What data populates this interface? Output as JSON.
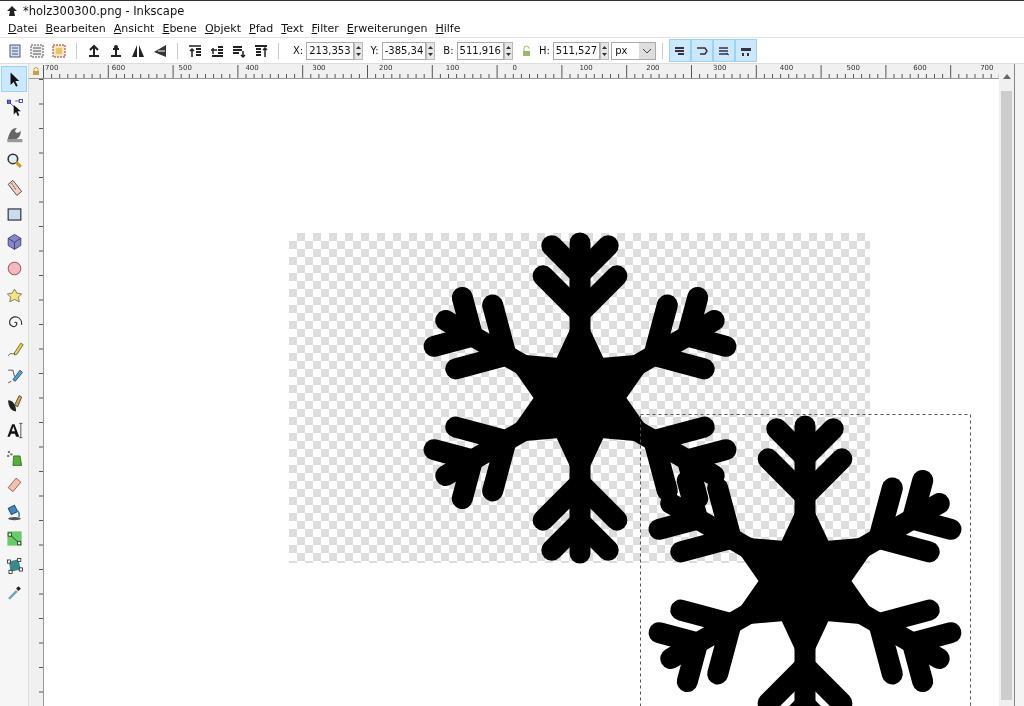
{
  "window": {
    "title": "*holz300300.png - Inkscape"
  },
  "menu": [
    {
      "label": "Datei"
    },
    {
      "label": "Bearbeiten"
    },
    {
      "label": "Ansicht"
    },
    {
      "label": "Ebene"
    },
    {
      "label": "Objekt"
    },
    {
      "label": "Pfad"
    },
    {
      "label": "Text"
    },
    {
      "label": "Filter"
    },
    {
      "label": "Erweiterungen"
    },
    {
      "label": "Hilfe"
    }
  ],
  "toolbar": {
    "fields": [
      {
        "label": "X:",
        "value": "213,353"
      },
      {
        "label": "Y:",
        "value": "-385,34"
      },
      {
        "label": "B:",
        "value": "511,916"
      },
      {
        "label": "H:",
        "value": "511,527"
      }
    ],
    "unit": "px",
    "toggles": [
      {
        "on": true
      },
      {
        "on": true
      },
      {
        "on": true
      },
      {
        "on": true
      }
    ]
  },
  "ruler": {
    "labels": [
      "700",
      "600",
      "500",
      "400",
      "300",
      "200",
      "100",
      "0",
      "100",
      "200",
      "300",
      "400",
      "500",
      "600",
      "700"
    ]
  },
  "tools": [
    {
      "selected": true
    },
    {
      "selected": false
    },
    {
      "selected": false
    },
    {
      "selected": false
    },
    {
      "selected": false
    },
    {
      "selected": false
    },
    {
      "selected": false
    },
    {
      "selected": false
    },
    {
      "selected": false
    },
    {
      "selected": false
    },
    {
      "selected": false
    },
    {
      "selected": false
    },
    {
      "selected": false
    },
    {
      "selected": false
    },
    {
      "selected": false
    },
    {
      "selected": false
    },
    {
      "selected": false
    },
    {
      "selected": false
    },
    {
      "selected": false
    },
    {
      "selected": false
    }
  ]
}
